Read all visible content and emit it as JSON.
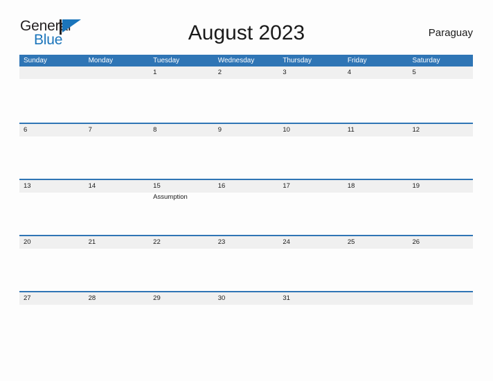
{
  "brand": {
    "name_part1": "General",
    "name_part2": "Blue",
    "flag_icon": "blue-triangle-flag-icon",
    "colors": {
      "text": "#231f20",
      "accent": "#1b75bb"
    }
  },
  "header": {
    "title": "August 2023",
    "country": "Paraguay"
  },
  "colors": {
    "header_blue": "#2f75b5",
    "band_gray": "#f0f0f0",
    "page_background": "#fdfdfd",
    "text": "#1a1a1a"
  },
  "calendar": {
    "month": "August",
    "year": "2023",
    "weekdays": [
      "Sunday",
      "Monday",
      "Tuesday",
      "Wednesday",
      "Thursday",
      "Friday",
      "Saturday"
    ],
    "weeks": [
      {
        "has_rule": false,
        "days": [
          {
            "num": "",
            "events": []
          },
          {
            "num": "",
            "events": []
          },
          {
            "num": "1",
            "events": []
          },
          {
            "num": "2",
            "events": []
          },
          {
            "num": "3",
            "events": []
          },
          {
            "num": "4",
            "events": []
          },
          {
            "num": "5",
            "events": []
          }
        ]
      },
      {
        "has_rule": true,
        "days": [
          {
            "num": "6",
            "events": []
          },
          {
            "num": "7",
            "events": []
          },
          {
            "num": "8",
            "events": []
          },
          {
            "num": "9",
            "events": []
          },
          {
            "num": "10",
            "events": []
          },
          {
            "num": "11",
            "events": []
          },
          {
            "num": "12",
            "events": []
          }
        ]
      },
      {
        "has_rule": true,
        "days": [
          {
            "num": "13",
            "events": []
          },
          {
            "num": "14",
            "events": []
          },
          {
            "num": "15",
            "events": [
              "Assumption"
            ]
          },
          {
            "num": "16",
            "events": []
          },
          {
            "num": "17",
            "events": []
          },
          {
            "num": "18",
            "events": []
          },
          {
            "num": "19",
            "events": []
          }
        ]
      },
      {
        "has_rule": true,
        "days": [
          {
            "num": "20",
            "events": []
          },
          {
            "num": "21",
            "events": []
          },
          {
            "num": "22",
            "events": []
          },
          {
            "num": "23",
            "events": []
          },
          {
            "num": "24",
            "events": []
          },
          {
            "num": "25",
            "events": []
          },
          {
            "num": "26",
            "events": []
          }
        ]
      },
      {
        "has_rule": true,
        "days": [
          {
            "num": "27",
            "events": []
          },
          {
            "num": "28",
            "events": []
          },
          {
            "num": "29",
            "events": []
          },
          {
            "num": "30",
            "events": []
          },
          {
            "num": "31",
            "events": []
          },
          {
            "num": "",
            "events": []
          },
          {
            "num": "",
            "events": []
          }
        ]
      }
    ]
  }
}
